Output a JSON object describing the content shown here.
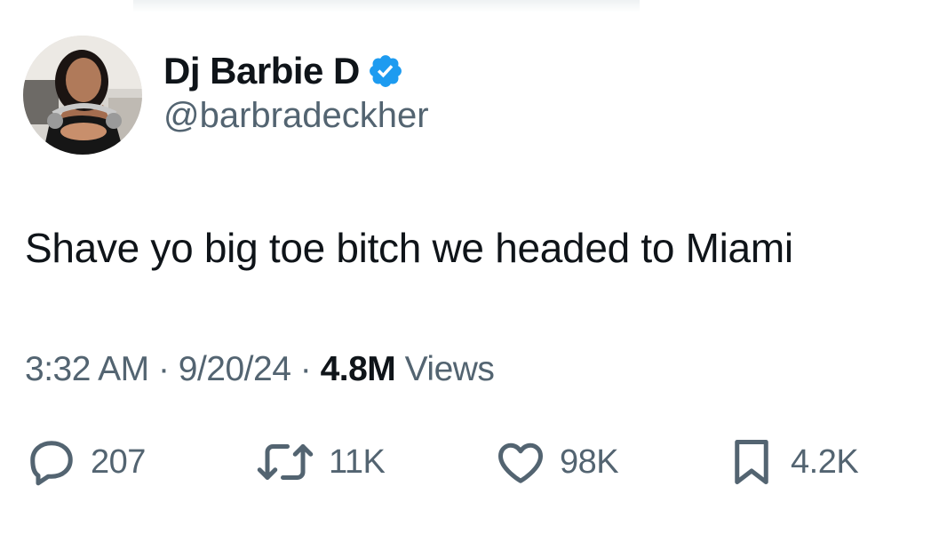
{
  "tweet": {
    "author": {
      "display_name": "Dj Barbie D",
      "handle": "@barbradeckher",
      "verified": true
    },
    "text": "Shave yo big toe bitch we headed to Miami",
    "time": "3:32 AM",
    "date": "9/20/24",
    "views_count": "4.8M",
    "views_label": "Views",
    "separator": "·"
  },
  "actions": {
    "replies": "207",
    "reposts": "11K",
    "likes": "98K",
    "bookmarks": "4.2K"
  },
  "colors": {
    "text_primary": "#0f1419",
    "text_secondary": "#536471",
    "verified_blue": "#1d9bf0",
    "background": "#ffffff"
  },
  "icons": {
    "verified": "verified-badge-icon",
    "reply": "reply-icon",
    "repost": "repost-icon",
    "like": "heart-icon",
    "bookmark": "bookmark-icon"
  }
}
